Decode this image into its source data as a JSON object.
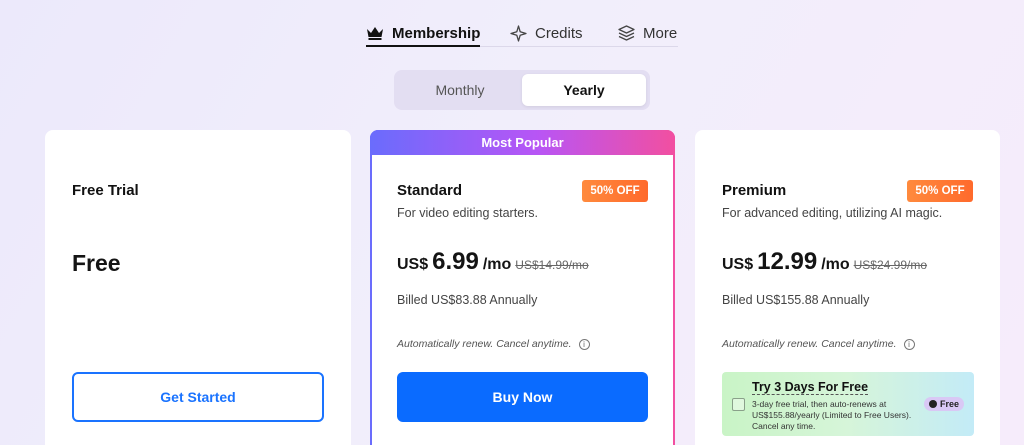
{
  "top_tabs": [
    {
      "label": "Membership",
      "icon": "crown-icon",
      "active": true
    },
    {
      "label": "Credits",
      "icon": "sparkle-icon",
      "active": false
    },
    {
      "label": "More",
      "icon": "layers-icon",
      "active": false
    }
  ],
  "billing_toggle": {
    "monthly": "Monthly",
    "yearly": "Yearly",
    "selected": "Yearly"
  },
  "plans": {
    "free": {
      "name": "Free Trial",
      "price": "Free",
      "cta": "Get Started"
    },
    "standard": {
      "banner": "Most Popular",
      "name": "Standard",
      "badge": "50% OFF",
      "desc": "For video editing starters.",
      "currency": "US$",
      "amount": "6.99",
      "per": "/mo",
      "old_price": "US$14.99/mo",
      "billed": "Billed US$83.88 Annually",
      "auto_renew": "Automatically renew. Cancel anytime.",
      "cta": "Buy Now"
    },
    "premium": {
      "name": "Premium",
      "badge": "50% OFF",
      "desc": "For advanced editing, utilizing AI magic.",
      "currency": "US$",
      "amount": "12.99",
      "per": "/mo",
      "old_price": "US$24.99/mo",
      "billed": "Billed US$155.88 Annually",
      "auto_renew": "Automatically renew. Cancel anytime.",
      "trial": {
        "title": "Try 3 Days For Free",
        "body": "3-day free trial, then auto-renews at US$155.88/yearly (Limited to Free Users). Cancel any time.",
        "tag": "Free"
      }
    }
  },
  "colors": {
    "accent_blue": "#0a6bff",
    "badge_orange": "#ff7a33",
    "popular_gradient_start": "#6a6cfc",
    "popular_gradient_end": "#f24fa0"
  }
}
